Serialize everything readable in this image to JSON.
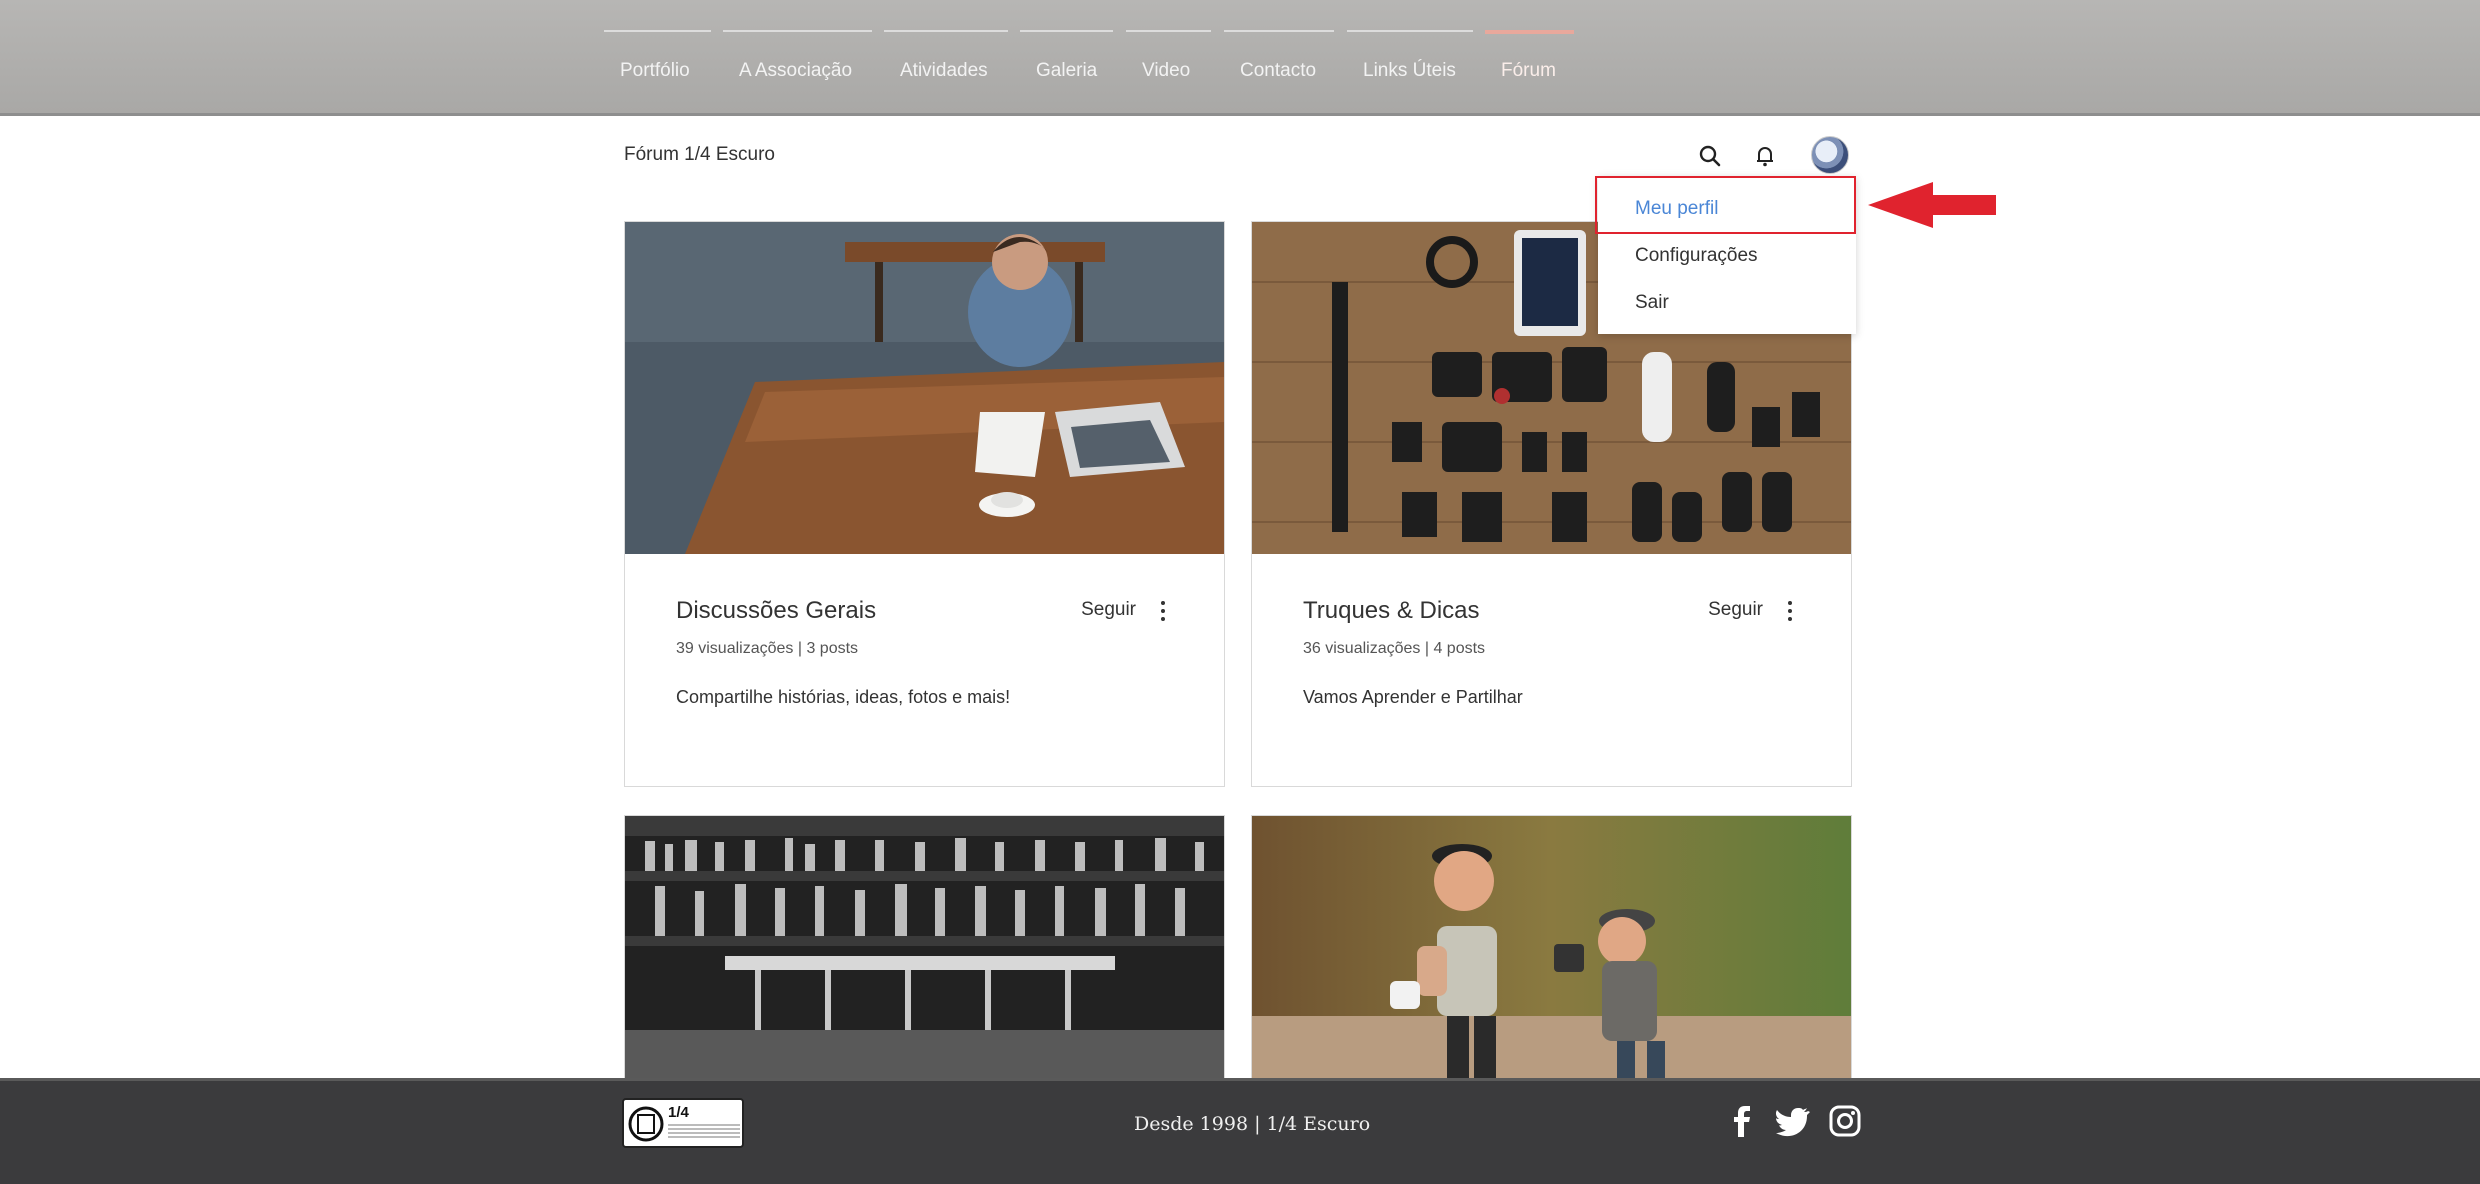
{
  "nav": {
    "items": [
      {
        "label": "Portfólio"
      },
      {
        "label": "A Associação"
      },
      {
        "label": "Atividades"
      },
      {
        "label": "Galeria"
      },
      {
        "label": "Video"
      },
      {
        "label": "Contacto"
      },
      {
        "label": "Links Úteis"
      },
      {
        "label": "Fórum",
        "active": true
      }
    ]
  },
  "forum": {
    "title": "Fórum 1/4 Escuro",
    "icons": [
      "search-icon",
      "bell-icon",
      "avatar"
    ]
  },
  "cards": [
    {
      "title": "Discussões Gerais",
      "follow": "Seguir",
      "meta": "39 visualizações | 3 posts",
      "description": "Compartilhe histórias, ideas, fotos e mais!"
    },
    {
      "title": "Truques & Dicas",
      "follow": "Seguir",
      "meta": "36 visualizações | 4 posts",
      "description": "Vamos Aprender e Partilhar"
    },
    {
      "title": "",
      "follow": "",
      "meta": "",
      "description": ""
    },
    {
      "title": "",
      "follow": "",
      "meta": "",
      "description": ""
    }
  ],
  "dropdown": {
    "items": [
      {
        "label": "Meu perfil",
        "highlighted": true
      },
      {
        "label": "Configurações"
      },
      {
        "label": "Sair"
      }
    ]
  },
  "footer": {
    "text": "Desde 1998 | 1/4 Escuro",
    "logo_text": "1/4 ESCURO",
    "social": [
      "facebook-icon",
      "twitter-icon",
      "instagram-icon"
    ]
  },
  "colors": {
    "accent": "#e8a89c",
    "highlight_link": "#4a86d6",
    "annotation_red": "#e0232e",
    "footer_bg": "#3b3b3d"
  }
}
